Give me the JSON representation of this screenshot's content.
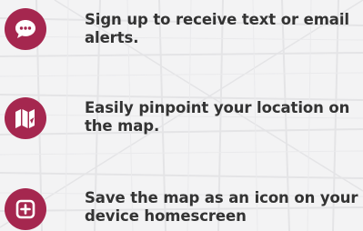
{
  "features": [
    {
      "icon": "chat-bubble-icon",
      "text": "Sign up to receive text or email alerts."
    },
    {
      "icon": "map-icon",
      "text": "Easily pinpoint your location on the map."
    },
    {
      "icon": "add-square-icon",
      "text": "Save the map as an icon on your device homescreen"
    }
  ],
  "colors": {
    "accent": "#a5274f",
    "text": "#333333",
    "background": "#f3f3f4"
  }
}
